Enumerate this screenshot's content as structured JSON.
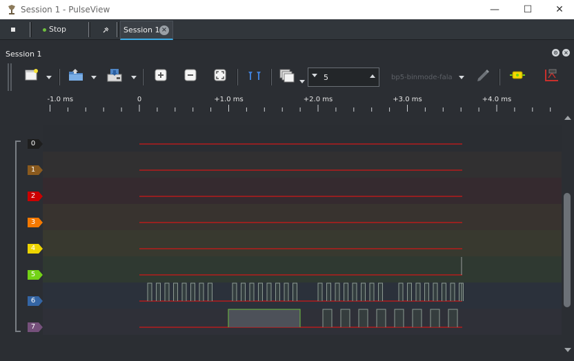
{
  "window": {
    "title": "Session 1 - PulseView",
    "minimize_glyph": "—",
    "maximize_glyph": "☐",
    "close_glyph": "✕"
  },
  "tabstrip": {
    "stop_label": "Stop",
    "stop_indicator_color": "#6fbf3f",
    "session_tab_label": "Session 1",
    "close_glyph": "×"
  },
  "session": {
    "header_label": "Session 1",
    "samples_value": "5",
    "device_name": "bp5-binmode-fala"
  },
  "ruler": {
    "labels": [
      "-1.0 ms",
      "0",
      "+1.0 ms",
      "+2.0 ms",
      "+3.0 ms",
      "+4.0 ms"
    ]
  },
  "channels": [
    {
      "name": "0",
      "color": "#1e1e1e"
    },
    {
      "name": "1",
      "color": "#8a5a1e"
    },
    {
      "name": "2",
      "color": "#cc0000"
    },
    {
      "name": "3",
      "color": "#f57900"
    },
    {
      "name": "4",
      "color": "#edd400"
    },
    {
      "name": "5",
      "color": "#73d216"
    },
    {
      "name": "6",
      "color": "#3465a4"
    },
    {
      "name": "7",
      "color": "#75507b"
    }
  ],
  "icons": {
    "app": "pulseview-icon",
    "new": "new-view-icon",
    "open": "open-folder-icon",
    "save": "save-icon",
    "zoom_in": "zoom-in-icon",
    "zoom_out": "zoom-out-icon",
    "zoom_fit": "zoom-fit-icon",
    "cursor": "cursor-icon",
    "samples": "sample-count-icon",
    "config": "device-config-icon",
    "channels": "channels-icon",
    "decoder": "decoder-icon"
  }
}
